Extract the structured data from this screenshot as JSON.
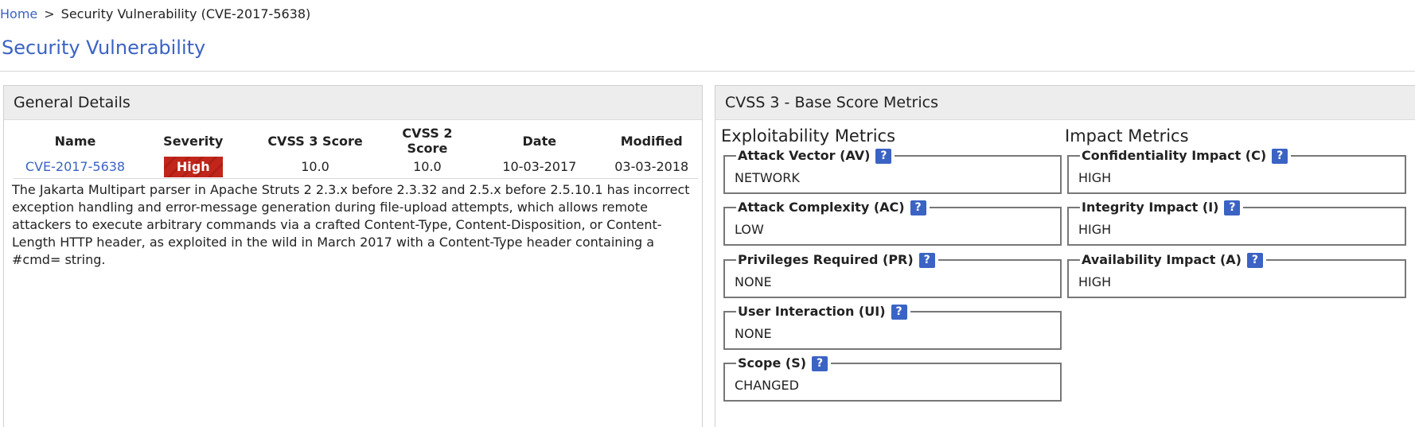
{
  "breadcrumb": {
    "home": "Home",
    "separator": ">",
    "current": "Security Vulnerability (CVE-2017-5638)"
  },
  "page_title": "Security Vulnerability",
  "general": {
    "title": "General Details",
    "headers": [
      "Name",
      "Severity",
      "CVSS 3 Score",
      "CVSS 2 Score",
      "Date",
      "Modified"
    ],
    "row": {
      "name": "CVE-2017-5638",
      "severity": "High",
      "cvss3": "10.0",
      "cvss2": "10.0",
      "date": "10-03-2017",
      "modified": "03-03-2018"
    },
    "description": "The Jakarta Multipart parser in Apache Struts 2 2.3.x before 2.3.32 and 2.5.x before 2.5.10.1 has incorrect exception handling and error-message generation during file-upload attempts, which allows remote attackers to execute arbitrary commands via a crafted Content-Type, Content-Disposition, or Content-Length HTTP header, as exploited in the wild in March 2017 with a Content-Type header containing a #cmd= string."
  },
  "cvss": {
    "title": "CVSS 3 - Base Score Metrics",
    "exploitability": {
      "title": "Exploitability Metrics",
      "metrics": [
        {
          "label": "Attack Vector (AV)",
          "value": "NETWORK"
        },
        {
          "label": "Attack Complexity (AC)",
          "value": "LOW"
        },
        {
          "label": "Privileges Required (PR)",
          "value": "NONE"
        },
        {
          "label": "User Interaction (UI)",
          "value": "NONE"
        },
        {
          "label": "Scope (S)",
          "value": "CHANGED"
        }
      ]
    },
    "impact": {
      "title": "Impact Metrics",
      "metrics": [
        {
          "label": "Confidentiality Impact (C)",
          "value": "HIGH"
        },
        {
          "label": "Integrity Impact (I)",
          "value": "HIGH"
        },
        {
          "label": "Availability Impact (A)",
          "value": "HIGH"
        }
      ]
    },
    "help_glyph": "?"
  },
  "colors": {
    "link": "#3b63c4",
    "severity_high": "#c1261a",
    "help_icon": "#3b63c4"
  }
}
